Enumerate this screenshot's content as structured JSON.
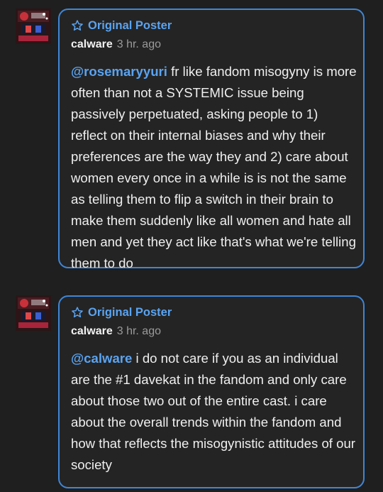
{
  "posts": [
    {
      "badge": "Original Poster",
      "username": "calware",
      "time": "3 hr. ago",
      "mention": "@rosemaryyuri",
      "text": " fr like fandom misogyny is more often than not a SYSTEMIC issue being passively perpetuated, asking people to 1) reflect on their internal biases and why their preferences are the way they and 2) care about women every once in a while is is not the same as telling them to flip a switch in their brain to make them suddenly like all women and hate all men and yet they act like that's what we're telling them to do"
    },
    {
      "badge": "Original Poster",
      "username": "calware",
      "time": "3 hr. ago",
      "mention": "@calware",
      "text": " i do not care if you as an individual are the #1 davekat in the fandom and only care about those two out of the entire cast. i care about the overall trends within the fandom and how that reflects the misogynistic attitudes of our society"
    }
  ],
  "colors": {
    "accent": "#3f86d8",
    "badge_text": "#5aa3f0",
    "background": "#1f1f1f"
  },
  "icons": {
    "badge": "star-outline-icon",
    "avatar": "user-avatar"
  }
}
